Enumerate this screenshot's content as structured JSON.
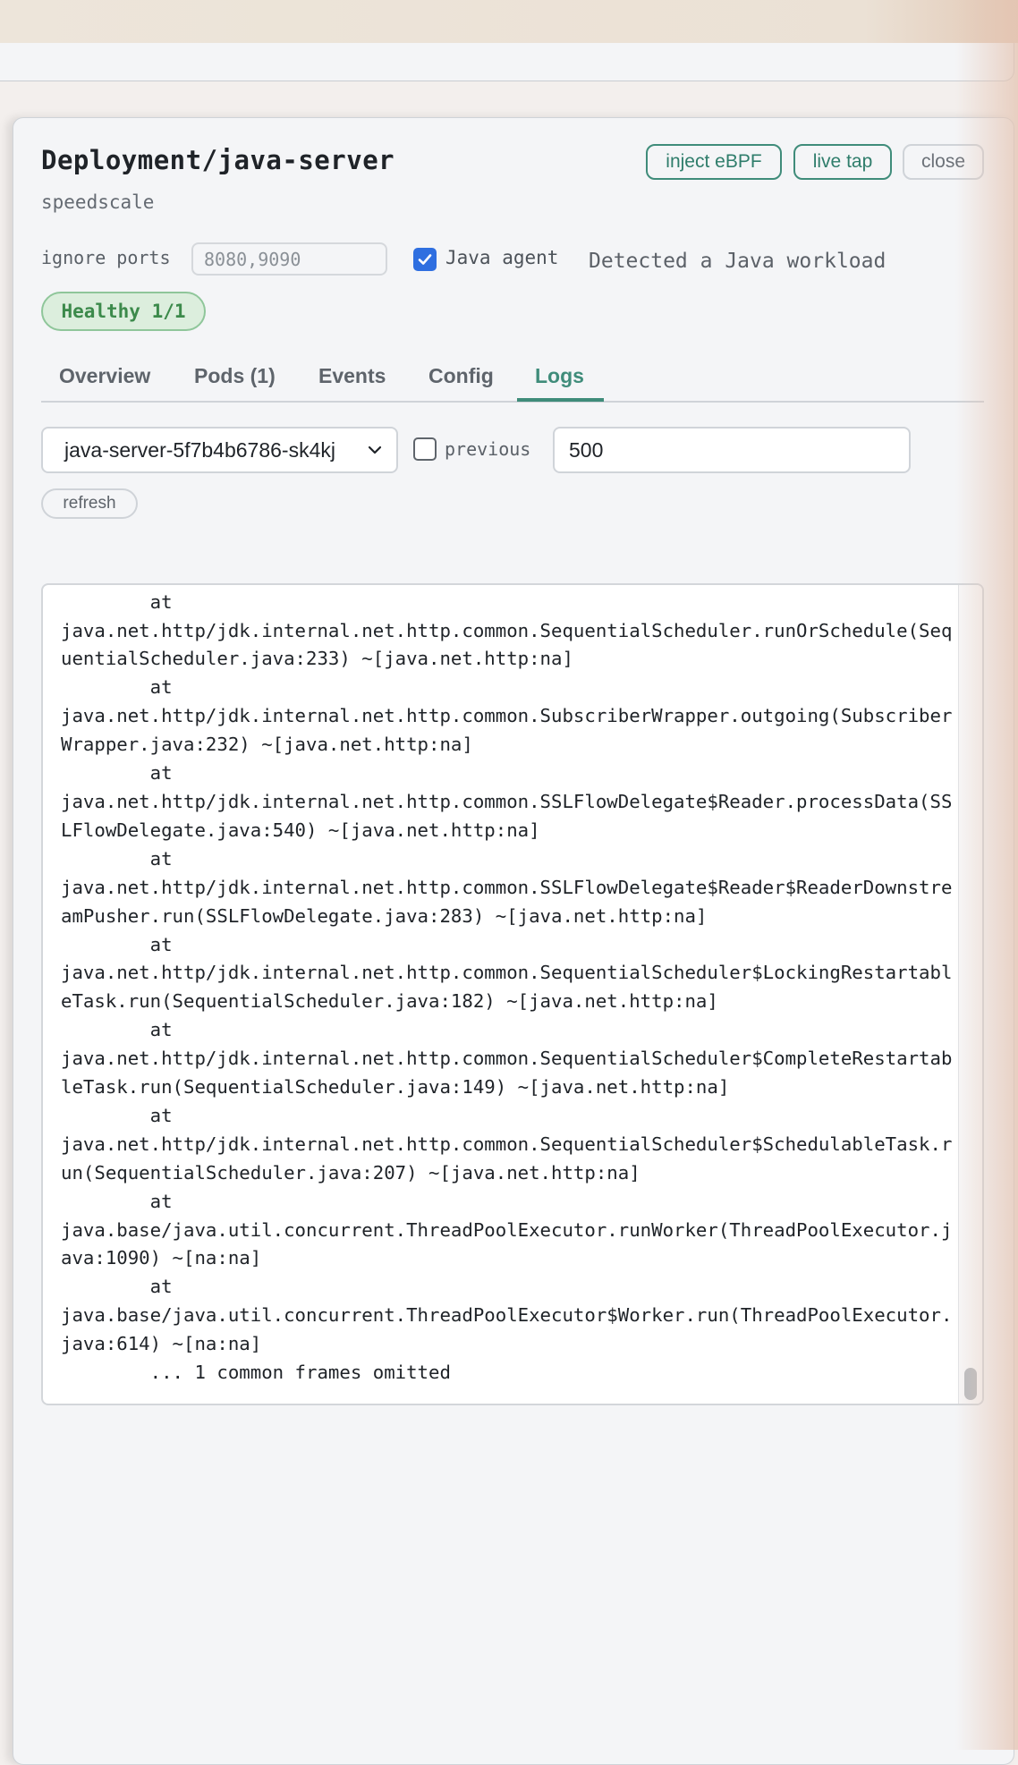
{
  "header": {
    "title": "Deployment/java-server",
    "namespace": "speedscale",
    "buttons": {
      "inject": "inject eBPF",
      "live_tap": "live tap",
      "close": "close"
    }
  },
  "options": {
    "ignore_ports_label": "ignore ports",
    "ignore_ports_value": "8080,9090",
    "java_agent_label": "Java agent",
    "java_agent_checked": true,
    "detected_text": "Detected a Java workload"
  },
  "status": {
    "health": "Healthy 1/1"
  },
  "tabs": [
    {
      "label": "Overview",
      "active": false
    },
    {
      "label": "Pods (1)",
      "active": false
    },
    {
      "label": "Events",
      "active": false
    },
    {
      "label": "Config",
      "active": false
    },
    {
      "label": "Logs",
      "active": true
    }
  ],
  "logs_controls": {
    "pod": "java-server-5f7b4b6786-sk4kj",
    "previous_label": "previous",
    "previous_checked": false,
    "tail_lines": "500",
    "refresh_label": "refresh"
  },
  "log_output": "        at\njava.net.http/jdk.internal.net.http.common.SequentialScheduler.runOrSchedule(SequentialScheduler.java:233) ~[java.net.http:na]\n        at\njava.net.http/jdk.internal.net.http.common.SubscriberWrapper.outgoing(SubscriberWrapper.java:232) ~[java.net.http:na]\n        at\njava.net.http/jdk.internal.net.http.common.SSLFlowDelegate$Reader.processData(SSLFlowDelegate.java:540) ~[java.net.http:na]\n        at\njava.net.http/jdk.internal.net.http.common.SSLFlowDelegate$Reader$ReaderDownstreamPusher.run(SSLFlowDelegate.java:283) ~[java.net.http:na]\n        at\njava.net.http/jdk.internal.net.http.common.SequentialScheduler$LockingRestartableTask.run(SequentialScheduler.java:182) ~[java.net.http:na]\n        at\njava.net.http/jdk.internal.net.http.common.SequentialScheduler$CompleteRestartableTask.run(SequentialScheduler.java:149) ~[java.net.http:na]\n        at\njava.net.http/jdk.internal.net.http.common.SequentialScheduler$SchedulableTask.run(SequentialScheduler.java:207) ~[java.net.http:na]\n        at\njava.base/java.util.concurrent.ThreadPoolExecutor.runWorker(ThreadPoolExecutor.java:1090) ~[na:na]\n        at\njava.base/java.util.concurrent.ThreadPoolExecutor$Worker.run(ThreadPoolExecutor.java:614) ~[na:na]\n        ... 1 common frames omitted",
  "colors": {
    "accent": "#3f8c7a",
    "healthy_bg": "#dceedd",
    "healthy_text": "#3c8a4b",
    "checkbox_blue": "#2f6fe0"
  }
}
